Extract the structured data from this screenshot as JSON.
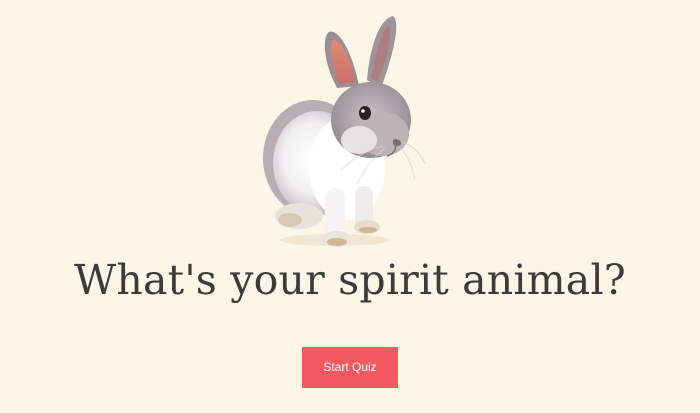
{
  "page": {
    "background_color": "#fdf5e6"
  },
  "hero": {
    "image": "rabbit-photo",
    "title": "What's your spirit animal?",
    "title_color": "#3b3b3b"
  },
  "actions": {
    "start_label": "Start Quiz",
    "start_color": "#f4595f"
  }
}
